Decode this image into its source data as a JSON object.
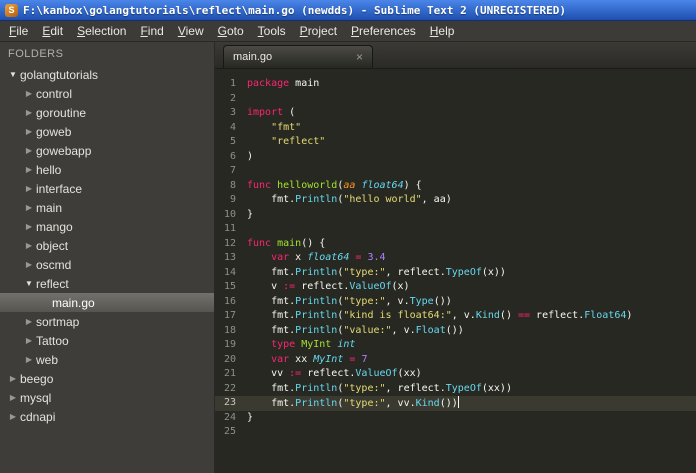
{
  "window": {
    "title": "F:\\kanbox\\golangtutorials\\reflect\\main.go (newdds) - Sublime Text 2 (UNREGISTERED)"
  },
  "menu": {
    "items": [
      "File",
      "Edit",
      "Selection",
      "Find",
      "View",
      "Goto",
      "Tools",
      "Project",
      "Preferences",
      "Help"
    ]
  },
  "icons": {
    "collapsed": "▶",
    "expanded": "▼",
    "close": "×",
    "app_glyph": "S"
  },
  "theme": {
    "titlebar_blue": "#2a62c6",
    "editor_bg": "#272822",
    "sidebar_bg": "#3e3d39",
    "active_line_bg": "#3b3a30",
    "syntax_colors": {
      "keyword": "#f92672",
      "function": "#a6e22e",
      "type": "#66d9ef",
      "call": "#66d9ef",
      "string": "#e6db74",
      "number": "#ae81ff",
      "parameter": "#fd971f",
      "plain": "#f8f8f2",
      "line_number": "#8f908a"
    }
  },
  "sidebar": {
    "header": "FOLDERS",
    "items": [
      {
        "label": "golangtutorials",
        "level": 0,
        "type": "folder",
        "state": "open"
      },
      {
        "label": "control",
        "level": 1,
        "type": "folder",
        "state": "closed"
      },
      {
        "label": "goroutine",
        "level": 1,
        "type": "folder",
        "state": "closed"
      },
      {
        "label": "goweb",
        "level": 1,
        "type": "folder",
        "state": "closed"
      },
      {
        "label": "gowebapp",
        "level": 1,
        "type": "folder",
        "state": "closed"
      },
      {
        "label": "hello",
        "level": 1,
        "type": "folder",
        "state": "closed"
      },
      {
        "label": "interface",
        "level": 1,
        "type": "folder",
        "state": "closed"
      },
      {
        "label": "main",
        "level": 1,
        "type": "folder",
        "state": "closed"
      },
      {
        "label": "mango",
        "level": 1,
        "type": "folder",
        "state": "closed"
      },
      {
        "label": "object",
        "level": 1,
        "type": "folder",
        "state": "closed"
      },
      {
        "label": "oscmd",
        "level": 1,
        "type": "folder",
        "state": "closed"
      },
      {
        "label": "reflect",
        "level": 1,
        "type": "folder",
        "state": "open"
      },
      {
        "label": "main.go",
        "level": 2,
        "type": "file",
        "selected": true
      },
      {
        "label": "sortmap",
        "level": 1,
        "type": "folder",
        "state": "closed"
      },
      {
        "label": "Tattoo",
        "level": 1,
        "type": "folder",
        "state": "closed"
      },
      {
        "label": "web",
        "level": 1,
        "type": "folder",
        "state": "closed"
      },
      {
        "label": "beego",
        "level": 0,
        "type": "folder",
        "state": "closed"
      },
      {
        "label": "mysql",
        "level": 0,
        "type": "folder",
        "state": "closed"
      },
      {
        "label": "cdnapi",
        "level": 0,
        "type": "folder",
        "state": "closed"
      }
    ]
  },
  "tabs": [
    {
      "label": "main.go",
      "active": true
    }
  ],
  "editor": {
    "cursor_line": 23,
    "lines": [
      [
        [
          "k",
          "package"
        ],
        [
          "w",
          " main"
        ]
      ],
      [],
      [
        [
          "k",
          "import"
        ],
        [
          "w",
          " ("
        ]
      ],
      [
        [
          "w",
          "    "
        ],
        [
          "s",
          "\"fmt\""
        ]
      ],
      [
        [
          "w",
          "    "
        ],
        [
          "s",
          "\"reflect\""
        ]
      ],
      [
        [
          "w",
          ")"
        ]
      ],
      [],
      [
        [
          "k",
          "func"
        ],
        [
          "w",
          " "
        ],
        [
          "f",
          "helloworld"
        ],
        [
          "w",
          "("
        ],
        [
          "p",
          "aa"
        ],
        [
          "w",
          " "
        ],
        [
          "t",
          "float64"
        ],
        [
          "w",
          ") {"
        ]
      ],
      [
        [
          "w",
          "    fmt."
        ],
        [
          "c",
          "Println"
        ],
        [
          "w",
          "("
        ],
        [
          "s",
          "\"hello world\""
        ],
        [
          "w",
          ", aa)"
        ]
      ],
      [
        [
          "w",
          "}"
        ]
      ],
      [],
      [
        [
          "k",
          "func"
        ],
        [
          "w",
          " "
        ],
        [
          "f",
          "main"
        ],
        [
          "w",
          "() {"
        ]
      ],
      [
        [
          "w",
          "    "
        ],
        [
          "k",
          "var"
        ],
        [
          "w",
          " x "
        ],
        [
          "t",
          "float64"
        ],
        [
          "w",
          " "
        ],
        [
          "k",
          "="
        ],
        [
          "w",
          " "
        ],
        [
          "n",
          "3.4"
        ]
      ],
      [
        [
          "w",
          "    fmt."
        ],
        [
          "c",
          "Println"
        ],
        [
          "w",
          "("
        ],
        [
          "s",
          "\"type:\""
        ],
        [
          "w",
          ", reflect."
        ],
        [
          "c",
          "TypeOf"
        ],
        [
          "w",
          "(x))"
        ]
      ],
      [
        [
          "w",
          "    v "
        ],
        [
          "k",
          ":="
        ],
        [
          "w",
          " reflect."
        ],
        [
          "c",
          "ValueOf"
        ],
        [
          "w",
          "(x)"
        ]
      ],
      [
        [
          "w",
          "    fmt."
        ],
        [
          "c",
          "Println"
        ],
        [
          "w",
          "("
        ],
        [
          "s",
          "\"type:\""
        ],
        [
          "w",
          ", v."
        ],
        [
          "c",
          "Type"
        ],
        [
          "w",
          "())"
        ]
      ],
      [
        [
          "w",
          "    fmt."
        ],
        [
          "c",
          "Println"
        ],
        [
          "w",
          "("
        ],
        [
          "s",
          "\"kind is float64:\""
        ],
        [
          "w",
          ", v."
        ],
        [
          "c",
          "Kind"
        ],
        [
          "w",
          "() "
        ],
        [
          "k",
          "=="
        ],
        [
          "w",
          " reflect."
        ],
        [
          "c",
          "Float64"
        ],
        [
          "w",
          ")"
        ]
      ],
      [
        [
          "w",
          "    fmt."
        ],
        [
          "c",
          "Println"
        ],
        [
          "w",
          "("
        ],
        [
          "s",
          "\"value:\""
        ],
        [
          "w",
          ", v."
        ],
        [
          "c",
          "Float"
        ],
        [
          "w",
          "())"
        ]
      ],
      [
        [
          "w",
          "    "
        ],
        [
          "k",
          "type"
        ],
        [
          "w",
          " "
        ],
        [
          "f",
          "MyInt"
        ],
        [
          "w",
          " "
        ],
        [
          "t",
          "int"
        ]
      ],
      [
        [
          "w",
          "    "
        ],
        [
          "k",
          "var"
        ],
        [
          "w",
          " xx "
        ],
        [
          "t",
          "MyInt"
        ],
        [
          "w",
          " "
        ],
        [
          "k",
          "="
        ],
        [
          "w",
          " "
        ],
        [
          "n",
          "7"
        ]
      ],
      [
        [
          "w",
          "    vv "
        ],
        [
          "k",
          ":="
        ],
        [
          "w",
          " reflect."
        ],
        [
          "c",
          "ValueOf"
        ],
        [
          "w",
          "(xx)"
        ]
      ],
      [
        [
          "w",
          "    fmt."
        ],
        [
          "c",
          "Println"
        ],
        [
          "w",
          "("
        ],
        [
          "s",
          "\"type:\""
        ],
        [
          "w",
          ", reflect."
        ],
        [
          "c",
          "TypeOf"
        ],
        [
          "w",
          "(xx))"
        ]
      ],
      [
        [
          "w",
          "    fmt."
        ],
        [
          "c",
          "Println"
        ],
        [
          "w",
          "("
        ],
        [
          "s",
          "\"type:\""
        ],
        [
          "w",
          ", vv."
        ],
        [
          "c",
          "Kind"
        ],
        [
          "w",
          "())"
        ]
      ],
      [
        [
          "w",
          "}"
        ]
      ],
      []
    ]
  }
}
